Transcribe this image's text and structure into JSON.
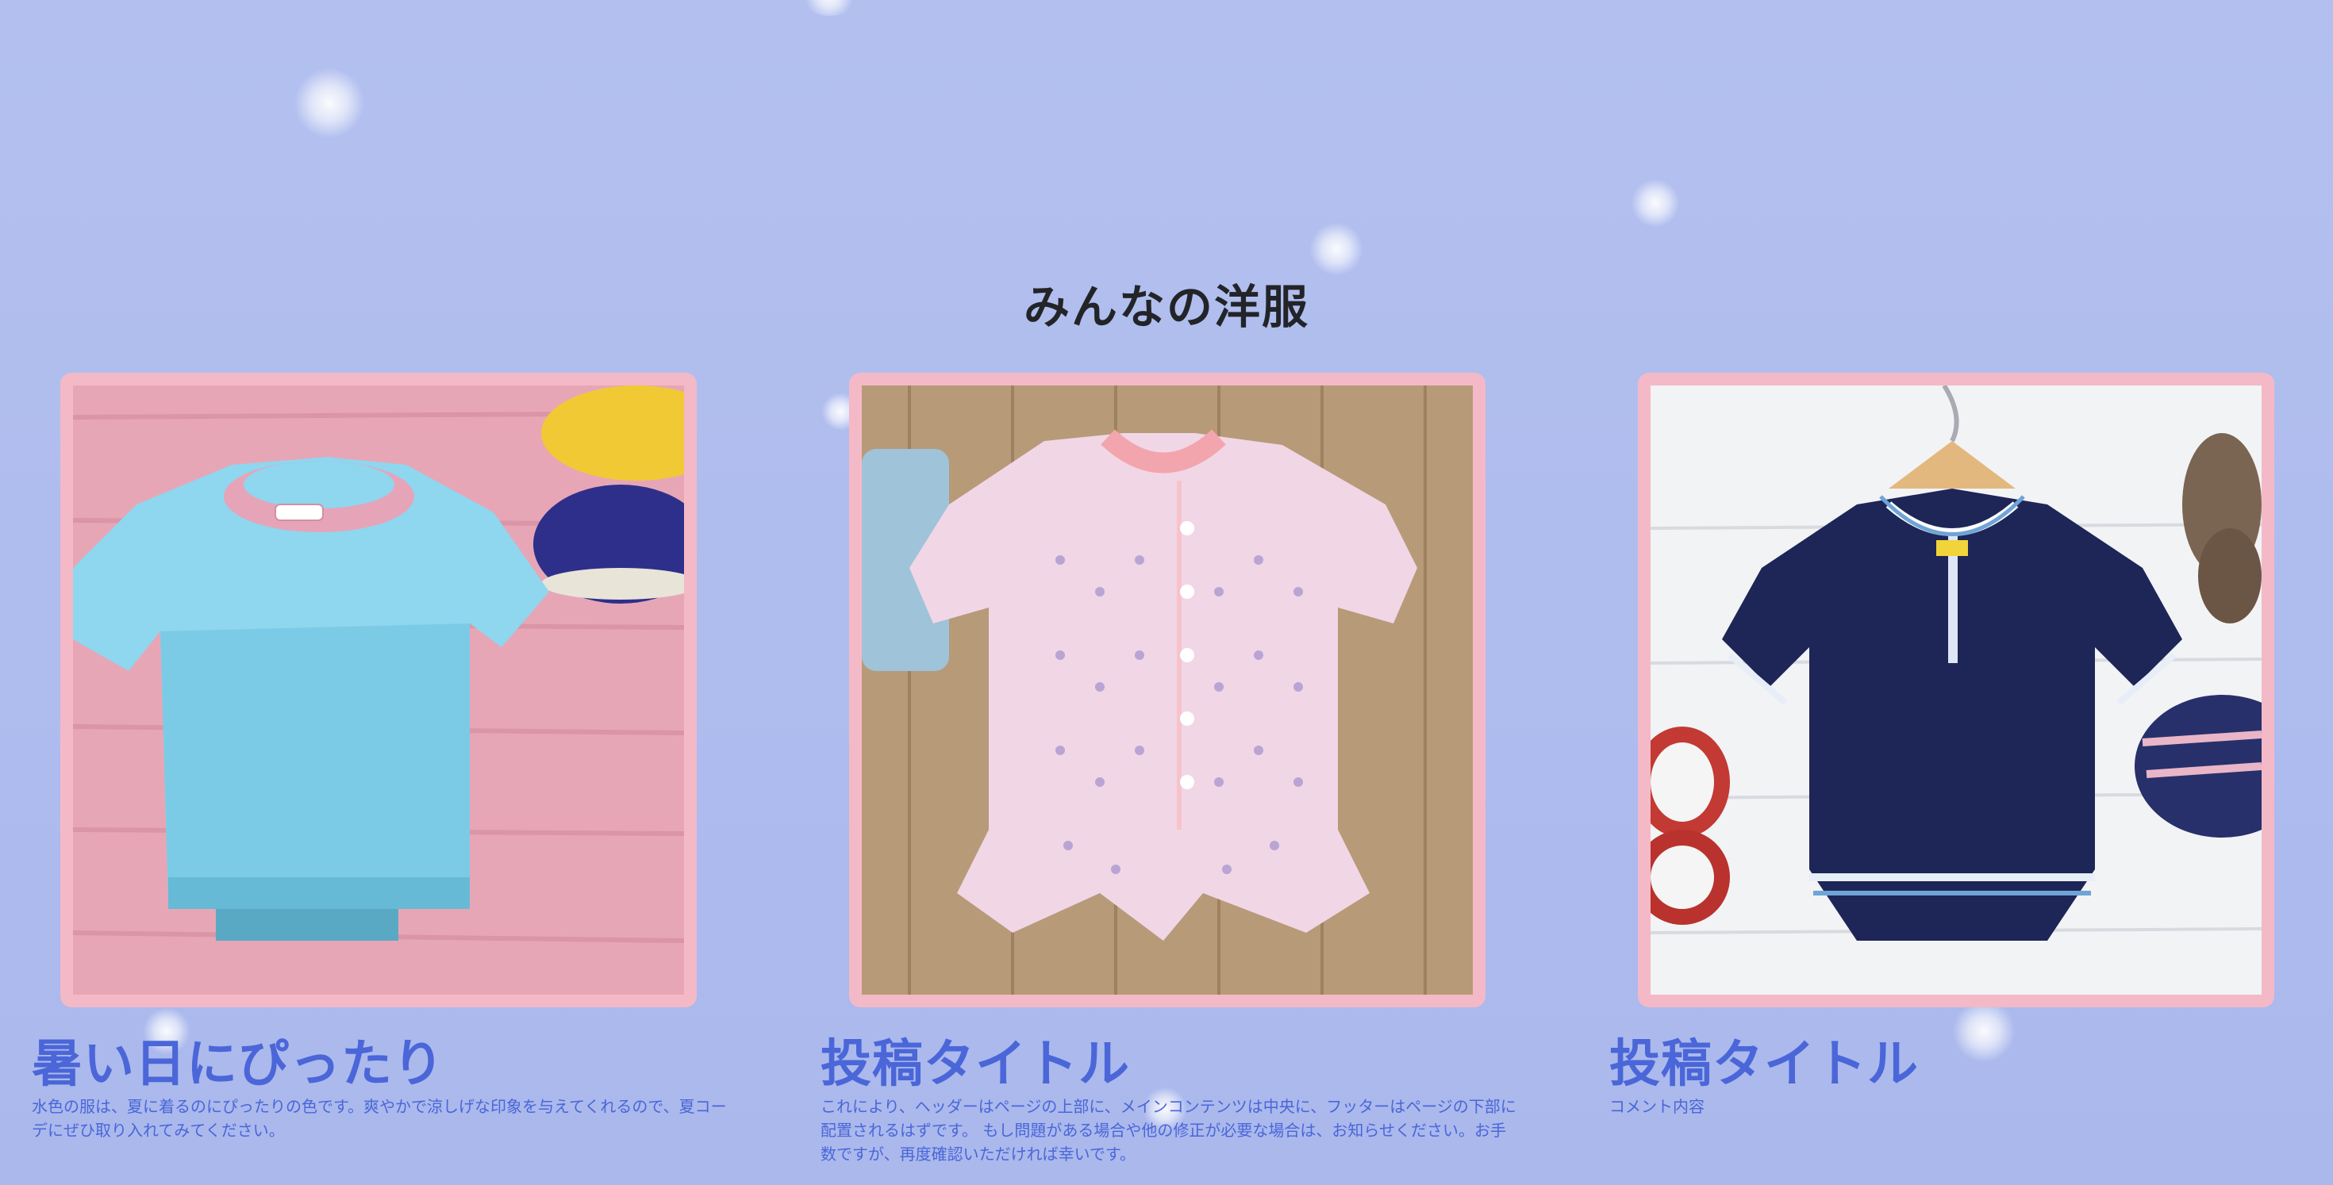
{
  "section": {
    "title": "みんなの洋服"
  },
  "posts": [
    {
      "title": "暑い日にぴったり",
      "comment": "水色の服は、夏に着るのにぴったりの色です。爽やかで涼しげな印象を与えてくれるので、夏コーデにぜひ取り入れてみてください。",
      "image": "light-blue-baby-tshirt-photo"
    },
    {
      "title": "投稿タイトル",
      "comment": "これにより、ヘッダーはページの上部に、メインコンテンツは中央に、フッターはページの下部に配置されるはずです。 もし問題がある場合や他の修正が必要な場合は、お知らせください。お手数ですが、再度確認いただければ幸いです。",
      "image": "pink-knit-baby-romper-photo"
    },
    {
      "title": "投稿タイトル",
      "comment": "コメント内容",
      "image": "navy-knit-baby-romper-photo"
    }
  ],
  "colors": {
    "background": "#b0bdee",
    "frame": "#f4b9c6",
    "post_text": "#4a66d8",
    "heading": "#222428"
  }
}
